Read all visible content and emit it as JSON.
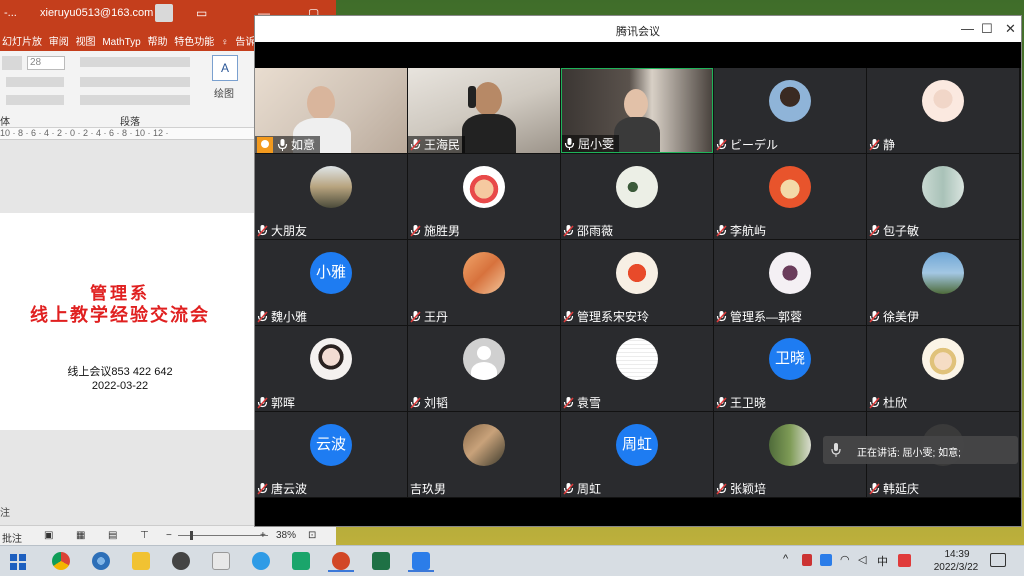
{
  "powerpoint": {
    "title_prefix": "-...",
    "account_email": "xieruyu0513@163.com",
    "tabs": [
      "幻灯片放",
      "审阅",
      "视图",
      "MathTyp",
      "帮助",
      "特色功能",
      "告诉我"
    ],
    "font_size": "28",
    "group_paragraph": "段落",
    "group_font_partial": "体",
    "drawing_label": "绘图",
    "ruler_text": "10 · 8 · 6 · 4 · 2 · 0 · 2 · 4 · 6 · 8 · 10 · 12 ·",
    "slide": {
      "department": "管理系",
      "title": "线上教学经验交流会",
      "meeting_line": "线上会议853 422 642",
      "date": "2022-03-22"
    },
    "notes_label": "注",
    "status": {
      "comments": "批注",
      "zoom": "38%"
    }
  },
  "meeting": {
    "window_title": "腾讯会议",
    "participants": [
      {
        "name": "如意",
        "kind": "video",
        "host": true,
        "mic": "on"
      },
      {
        "name": "王海民",
        "kind": "video",
        "mic": "muted"
      },
      {
        "name": "屈小雯",
        "kind": "video",
        "mic": "on",
        "speaking": true
      },
      {
        "name": "ビーデル",
        "kind": "avatar",
        "mic": "muted"
      },
      {
        "name": "静",
        "kind": "avatar",
        "mic": "muted"
      },
      {
        "name": "大朋友",
        "kind": "avatar",
        "mic": "muted"
      },
      {
        "name": "施胜男",
        "kind": "avatar",
        "mic": "muted"
      },
      {
        "name": "邵雨薇",
        "kind": "avatar",
        "mic": "muted"
      },
      {
        "name": "李航屿",
        "kind": "avatar",
        "mic": "muted"
      },
      {
        "name": "包子敏",
        "kind": "avatar",
        "mic": "muted"
      },
      {
        "name": "魏小雅",
        "kind": "text",
        "avatar_text": "小雅",
        "mic": "muted"
      },
      {
        "name": "王丹",
        "kind": "avatar",
        "mic": "muted"
      },
      {
        "name": "管理系宋安玲",
        "kind": "avatar",
        "mic": "muted"
      },
      {
        "name": "管理系—郭蓉",
        "kind": "avatar",
        "mic": "muted"
      },
      {
        "name": "徐美伊",
        "kind": "avatar",
        "mic": "muted"
      },
      {
        "name": "郭晖",
        "kind": "avatar",
        "mic": "muted"
      },
      {
        "name": "刘韬",
        "kind": "avatar",
        "mic": "muted"
      },
      {
        "name": "袁雪",
        "kind": "avatar",
        "mic": "muted"
      },
      {
        "name": "王卫晓",
        "kind": "text",
        "avatar_text": "卫晓",
        "mic": "muted"
      },
      {
        "name": "杜欣",
        "kind": "avatar",
        "mic": "muted"
      },
      {
        "name": "唐云波",
        "kind": "text",
        "avatar_text": "云波",
        "mic": "muted"
      },
      {
        "name": "吉玖男",
        "kind": "avatar",
        "mic": "none"
      },
      {
        "name": "周虹",
        "kind": "text",
        "avatar_text": "周虹",
        "mic": "muted"
      },
      {
        "name": "张颖培",
        "kind": "avatar",
        "mic": "muted"
      },
      {
        "name": "韩延庆",
        "kind": "avatar",
        "mic": "muted"
      }
    ],
    "speaking_indicator": "正在讲话: 屈小雯; 如意;"
  },
  "taskbar": {
    "apps": [
      "chrome",
      "browser",
      "file-explorer",
      "media-player",
      "sketch",
      "app-blue",
      "app-teal",
      "powerpoint",
      "excel",
      "tencent-meeting"
    ],
    "tray_ime": "中",
    "time": "14:39",
    "date": "2022/3/22"
  },
  "colors": {
    "ppt_red": "#c43e1c",
    "slide_title_red": "#e02020",
    "avatar_blue": "#1e7cf2",
    "tile_bg": "#2a2b2e",
    "speaking_border": "#1fb35a",
    "host_badge": "#f39a1e"
  }
}
